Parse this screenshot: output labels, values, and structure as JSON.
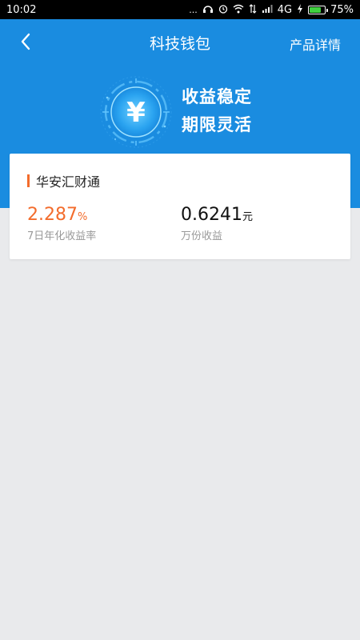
{
  "status_bar": {
    "time": "10:02",
    "dots": "...",
    "network": "4G",
    "battery_percent": "75%",
    "battery_level": 0.75
  },
  "header": {
    "title": "科技钱包",
    "right_link": "产品详情",
    "bg_color": "#1a8ce0"
  },
  "hero": {
    "line1": "收益稳定",
    "line2": "期限灵活",
    "emblem_symbol": "¥"
  },
  "product": {
    "name": "华安汇财通",
    "annual_rate": "2.287",
    "annual_rate_unit": "%",
    "annual_rate_label": "7日年化收益率",
    "daily_income": "0.6241",
    "daily_income_unit": "元",
    "daily_income_label": "万份收益",
    "accent_color": "#f36c2c"
  }
}
